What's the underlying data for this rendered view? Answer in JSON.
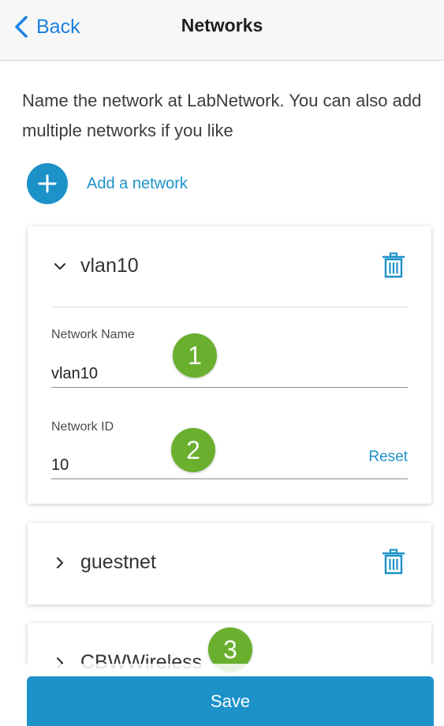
{
  "navbar": {
    "back_label": "Back",
    "title": "Networks"
  },
  "intro": {
    "text": "Name the network at LabNetwork. You can also add multiple networks if you like"
  },
  "add_network": {
    "label": "Add a network",
    "icon": "plus-icon"
  },
  "networks": [
    {
      "name": "vlan10",
      "expanded": true,
      "fields": {
        "network_name_label": "Network Name",
        "network_name_value": "vlan10",
        "network_id_label": "Network ID",
        "network_id_value": "10",
        "reset_label": "Reset"
      }
    },
    {
      "name": "guestnet",
      "expanded": false
    },
    {
      "name": "CBWWireless",
      "expanded": false
    }
  ],
  "callouts": [
    "1",
    "2",
    "3"
  ],
  "save": {
    "label": "Save"
  },
  "colors": {
    "accent": "#1d92c9",
    "back_link": "#1a82e2",
    "callout": "#6aaf2d"
  }
}
